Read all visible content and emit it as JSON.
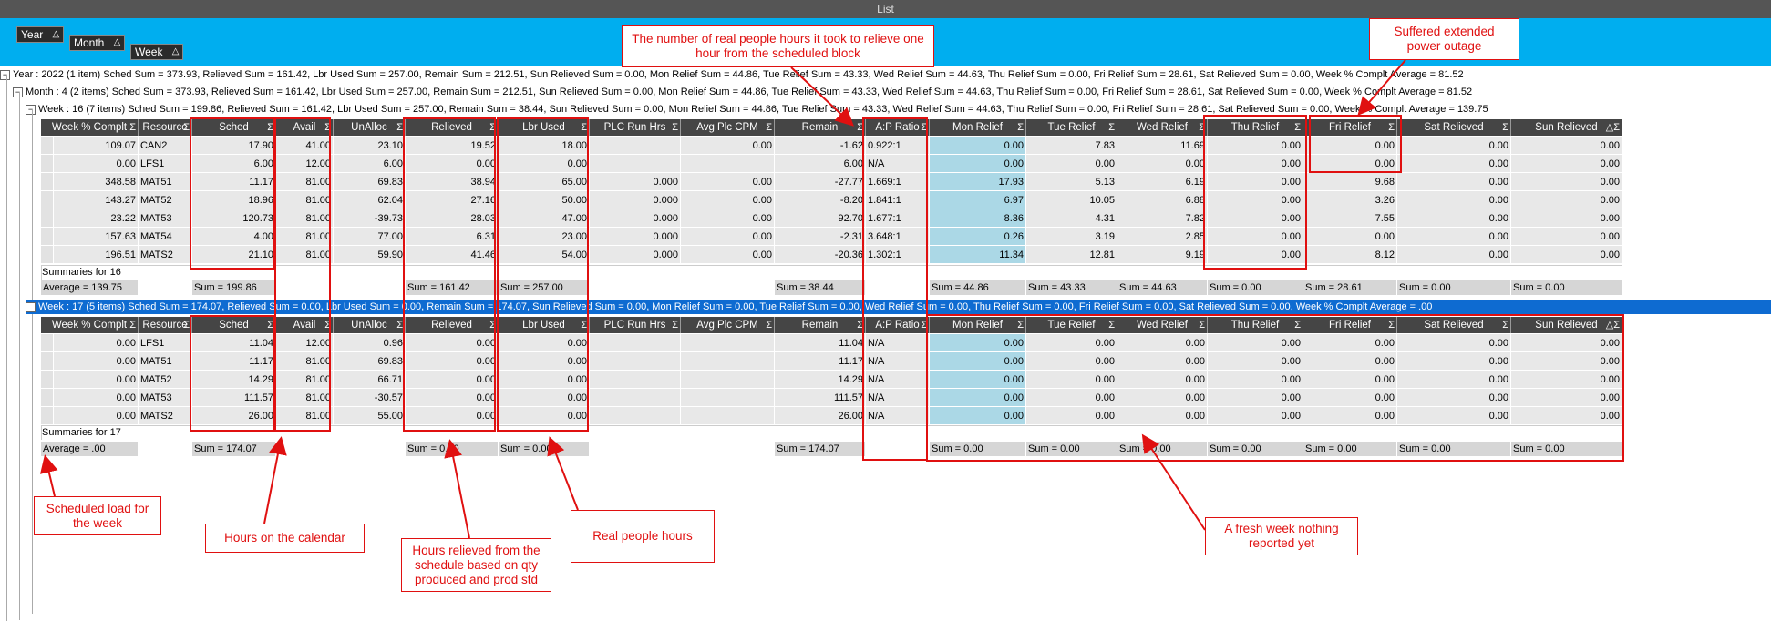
{
  "window": {
    "title": "List"
  },
  "group_chips": [
    {
      "id": "year",
      "label": "Year",
      "icon": "sort-up-icon"
    },
    {
      "id": "month",
      "label": "Month",
      "icon": "sort-up-icon"
    },
    {
      "id": "week",
      "label": "Week",
      "icon": "sort-up-icon"
    }
  ],
  "group_rows": {
    "year": "Year : 2022 (1 item) Sched Sum = 373.93, Relieved Sum = 161.42, Lbr Used Sum = 257.00, Remain Sum = 212.51, Sun Relieved Sum = 0.00, Mon Relief Sum = 44.86, Tue Relief Sum = 43.33, Wed Relief Sum = 44.63, Thu Relief Sum = 0.00, Fri Relief Sum = 28.61, Sat Relieved Sum = 0.00, Week % Complt Average = 81.52",
    "month": "Month : 4 (2 items) Sched Sum = 373.93, Relieved Sum = 161.42, Lbr Used Sum = 257.00, Remain Sum = 212.51, Sun Relieved Sum = 0.00, Mon Relief Sum = 44.86, Tue Relief Sum = 43.33, Wed Relief Sum = 44.63, Thu Relief Sum = 0.00, Fri Relief Sum = 28.61, Sat Relieved Sum = 0.00, Week % Complt Average = 81.52",
    "week16": "Week : 16 (7 items) Sched Sum = 199.86, Relieved Sum = 161.42, Lbr Used Sum = 257.00, Remain Sum = 38.44, Sun Relieved Sum = 0.00, Mon Relief Sum = 44.86, Tue Relief Sum = 43.33, Wed Relief Sum = 44.63, Thu Relief Sum = 0.00, Fri Relief Sum = 28.61, Sat Relieved Sum = 0.00, Week % Complt Average = 139.75",
    "week17": "Week : 17 (5 items) Sched Sum = 174.07, Relieved Sum = 0.00, Lbr Used Sum = 0.00, Remain Sum = 174.07, Sun Relieved Sum = 0.00, Mon Relief Sum = 0.00, Tue Relief Sum = 0.00, Wed Relief Sum = 0.00, Thu Relief Sum = 0.00, Fri Relief Sum = 0.00, Sat Relieved Sum = 0.00, Week % Complt Average = .00"
  },
  "columns": [
    {
      "label": "Week % Complt",
      "icon": "sum-icon"
    },
    {
      "label": "Resource",
      "icon": "sum-icon"
    },
    {
      "label": "Sched",
      "icon": "sum-icon"
    },
    {
      "label": "Avail",
      "icon": "sum-icon"
    },
    {
      "label": "UnAlloc",
      "icon": "sum-icon"
    },
    {
      "label": "Relieved",
      "icon": "sum-icon"
    },
    {
      "label": "Lbr Used",
      "icon": "sum-icon"
    },
    {
      "label": "PLC Run Hrs",
      "icon": "sum-icon"
    },
    {
      "label": "Avg Plc CPM",
      "icon": "sum-icon"
    },
    {
      "label": "Remain",
      "icon": "sum-icon"
    },
    {
      "label": "A:P Ratio",
      "icon": "sum-icon"
    },
    {
      "label": "Mon Relief",
      "icon": "sum-icon"
    },
    {
      "label": "Tue Relief",
      "icon": "sum-icon"
    },
    {
      "label": "Wed Relief",
      "icon": "sum-icon"
    },
    {
      "label": "Thu Relief",
      "icon": "sum-icon"
    },
    {
      "label": "Fri Relief",
      "icon": "sum-icon"
    },
    {
      "label": "Sat Relieved",
      "icon": "sum-icon"
    },
    {
      "label": "Sun Relieved",
      "icon": "sort-up-sum-icon"
    }
  ],
  "week16_rows": [
    [
      "109.07",
      "CAN2",
      "17.90",
      "41.00",
      "23.10",
      "19.52",
      "18.00",
      "",
      "0.00",
      "-1.62",
      "0.922:1",
      "0.00",
      "7.83",
      "11.69",
      "0.00",
      "0.00",
      "0.00",
      "0.00"
    ],
    [
      "0.00",
      "LFS1",
      "6.00",
      "12.00",
      "6.00",
      "0.00",
      "0.00",
      "",
      "",
      "6.00",
      "N/A",
      "0.00",
      "0.00",
      "0.00",
      "0.00",
      "0.00",
      "0.00",
      "0.00"
    ],
    [
      "348.58",
      "MAT51",
      "11.17",
      "81.00",
      "69.83",
      "38.94",
      "65.00",
      "0.000",
      "0.00",
      "-27.77",
      "1.669:1",
      "17.93",
      "5.13",
      "6.19",
      "0.00",
      "9.68",
      "0.00",
      "0.00"
    ],
    [
      "143.27",
      "MAT52",
      "18.96",
      "81.00",
      "62.04",
      "27.16",
      "50.00",
      "0.000",
      "0.00",
      "-8.20",
      "1.841:1",
      "6.97",
      "10.05",
      "6.88",
      "0.00",
      "3.26",
      "0.00",
      "0.00"
    ],
    [
      "23.22",
      "MAT53",
      "120.73",
      "81.00",
      "-39.73",
      "28.03",
      "47.00",
      "0.000",
      "0.00",
      "92.70",
      "1.677:1",
      "8.36",
      "4.31",
      "7.82",
      "0.00",
      "7.55",
      "0.00",
      "0.00"
    ],
    [
      "157.63",
      "MAT54",
      "4.00",
      "81.00",
      "77.00",
      "6.31",
      "23.00",
      "0.000",
      "0.00",
      "-2.31",
      "3.648:1",
      "0.26",
      "3.19",
      "2.85",
      "0.00",
      "0.00",
      "0.00",
      "0.00"
    ],
    [
      "196.51",
      "MATS2",
      "21.10",
      "81.00",
      "59.90",
      "41.46",
      "54.00",
      "0.000",
      "0.00",
      "-20.36",
      "1.302:1",
      "11.34",
      "12.81",
      "9.19",
      "0.00",
      "8.12",
      "0.00",
      "0.00"
    ]
  ],
  "week16_summary": {
    "title": "Summaries for 16",
    "cells": {
      "c0": "Average = 139.75",
      "c2": "Sum = 199.86",
      "c5": "Sum = 161.42",
      "c6": "Sum = 257.00",
      "c9": "Sum = 38.44",
      "c11": "Sum = 44.86",
      "c12": "Sum = 43.33",
      "c13": "Sum = 44.63",
      "c14": "Sum = 0.00",
      "c15": "Sum = 28.61",
      "c16": "Sum = 0.00",
      "c17": "Sum = 0.00"
    }
  },
  "week17_rows": [
    [
      "0.00",
      "LFS1",
      "11.04",
      "12.00",
      "0.96",
      "0.00",
      "0.00",
      "",
      "",
      "11.04",
      "N/A",
      "0.00",
      "0.00",
      "0.00",
      "0.00",
      "0.00",
      "0.00",
      "0.00"
    ],
    [
      "0.00",
      "MAT51",
      "11.17",
      "81.00",
      "69.83",
      "0.00",
      "0.00",
      "",
      "",
      "11.17",
      "N/A",
      "0.00",
      "0.00",
      "0.00",
      "0.00",
      "0.00",
      "0.00",
      "0.00"
    ],
    [
      "0.00",
      "MAT52",
      "14.29",
      "81.00",
      "66.71",
      "0.00",
      "0.00",
      "",
      "",
      "14.29",
      "N/A",
      "0.00",
      "0.00",
      "0.00",
      "0.00",
      "0.00",
      "0.00",
      "0.00"
    ],
    [
      "0.00",
      "MAT53",
      "111.57",
      "81.00",
      "-30.57",
      "0.00",
      "0.00",
      "",
      "",
      "111.57",
      "N/A",
      "0.00",
      "0.00",
      "0.00",
      "0.00",
      "0.00",
      "0.00",
      "0.00"
    ],
    [
      "0.00",
      "MATS2",
      "26.00",
      "81.00",
      "55.00",
      "0.00",
      "0.00",
      "",
      "",
      "26.00",
      "N/A",
      "0.00",
      "0.00",
      "0.00",
      "0.00",
      "0.00",
      "0.00",
      "0.00"
    ]
  ],
  "week17_summary": {
    "title": "Summaries for 17",
    "cells": {
      "c0": "Average = .00",
      "c2": "Sum = 174.07",
      "c5": "Sum = 0.00",
      "c6": "Sum = 0.00",
      "c9": "Sum = 174.07",
      "c11": "Sum = 0.00",
      "c12": "Sum = 0.00",
      "c13": "Sum = 0.00",
      "c14": "Sum = 0.00",
      "c15": "Sum = 0.00",
      "c16": "Sum = 0.00",
      "c17": "Sum = 0.00"
    }
  },
  "annotations": {
    "ap_ratio": "The number of real people hours it took to relieve one hour from the scheduled block",
    "power_outage": "Suffered extended power outage",
    "sched": "Scheduled load for the week",
    "avail": "Hours on the calendar",
    "relieved": "Hours relieved from the schedule based on qty produced and prod std",
    "lbr_used": "Real people hours",
    "fresh_week": "A fresh week nothing reported yet"
  },
  "colors": {
    "annotation": "#e01010",
    "group_bar": "#00aeef",
    "selected_row": "#0e6bd1",
    "header": "#454545",
    "mon_cell": "#abd8e6"
  }
}
